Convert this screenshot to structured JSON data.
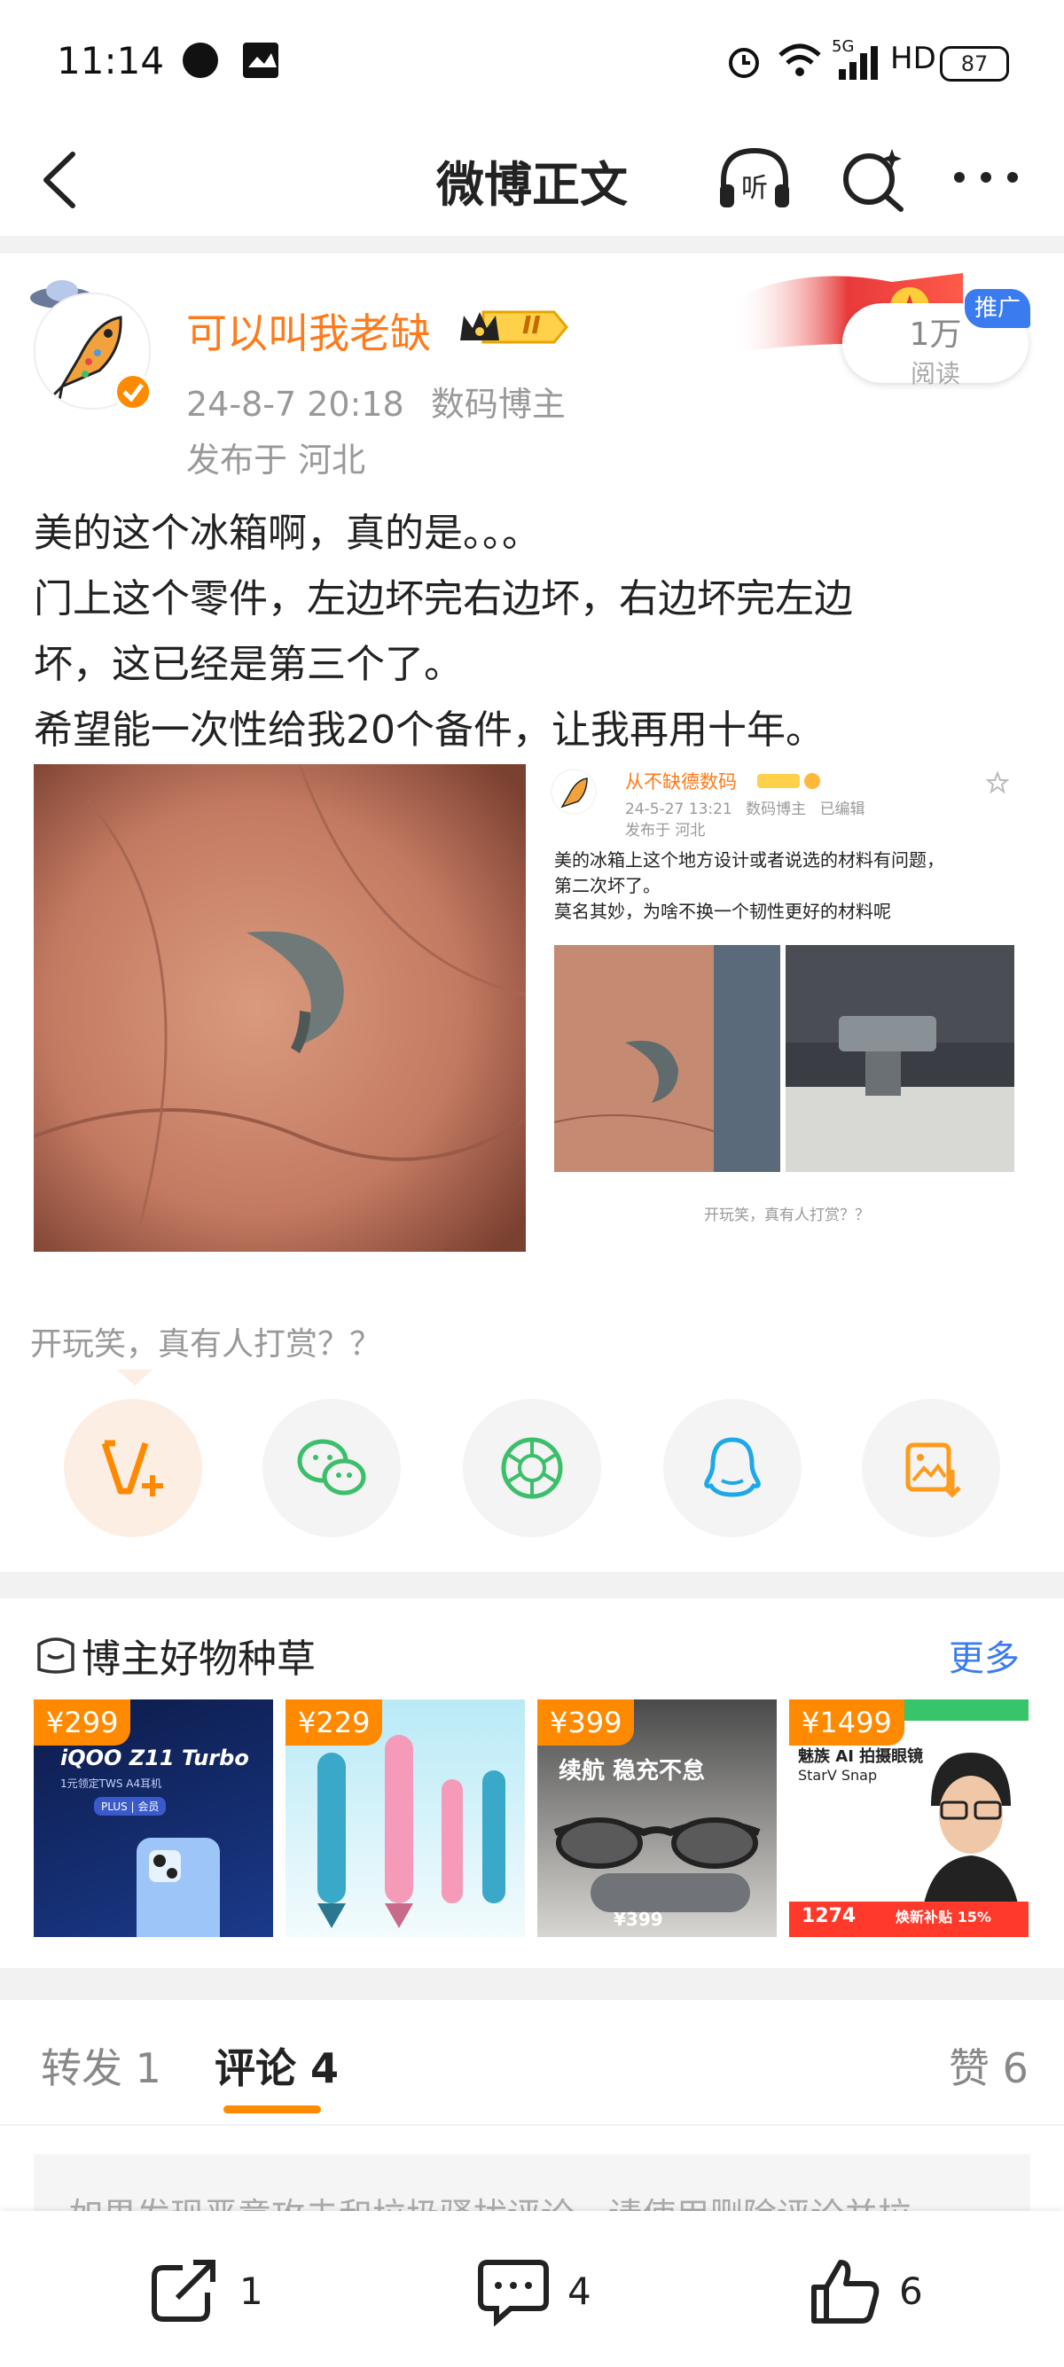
{
  "status_bar": {
    "time": "11:14",
    "network": "5G",
    "hd": "HD",
    "battery": "87"
  },
  "nav": {
    "title": "微博正文"
  },
  "post": {
    "username": "可以叫我老缺",
    "badge_level": "II",
    "date": "24-8-7 20:18",
    "tag": "数码博主",
    "location": "发布于 河北",
    "reads_count": "1万",
    "reads_label": "阅读",
    "promo_label": "推广",
    "text_lines": [
      "美的这个冰箱啊，真的是。。。",
      "门上这个零件，左边坏完右边坏，右边坏完左边",
      "坏，这已经是第三个了。",
      "希望能一次性给我20个备件，让我再用十年。"
    ],
    "quoted": {
      "username": "从不缺德数码",
      "date": "24-5-27 13:21",
      "tag": "数码博主",
      "edited": "已编辑",
      "location": "发布于 河北",
      "text_lines": [
        "美的冰箱上这个地方设计或者说选的材料有问题，",
        "第二次坏了。",
        "莫名其妙，为啥不换一个韧性更好的材料呢"
      ],
      "caption": "开玩笑，真有人打赏？？"
    },
    "caption": "开玩笑，真有人打赏？？"
  },
  "share": {
    "items": [
      "vplus-icon",
      "wechat-icon",
      "moments-icon",
      "qq-icon",
      "save-image-icon"
    ]
  },
  "goods": {
    "title": "博主好物种草",
    "more": "更多",
    "items": [
      {
        "price": "¥299",
        "headline": "iQOO Z11 Turbo",
        "sub": "1元领定TWS A4耳机",
        "tag": "PLUS | 会员"
      },
      {
        "price": "¥229",
        "headline": "",
        "sub": "",
        "tag": ""
      },
      {
        "price": "¥399",
        "headline": "续航 稳充不怠",
        "sub": "¥399",
        "tag": ""
      },
      {
        "price": "¥1499",
        "headline": "魅族 AI 拍摄眼镜",
        "sub": "StarV Snap",
        "tag": "1274",
        "promo": "焕新补贴 15%"
      }
    ]
  },
  "tabs": {
    "repost": "转发 1",
    "comment": "评论 4",
    "like": "赞 6"
  },
  "notice": "如果发现恶意攻击和垃圾骚扰评论，请使用删除评论并拉",
  "bottom": {
    "repost_count": "1",
    "comment_count": "4",
    "like_count": "6"
  },
  "colors": {
    "accent": "#ff8a00",
    "username": "#ff7a1a",
    "link": "#3a7cf0"
  }
}
